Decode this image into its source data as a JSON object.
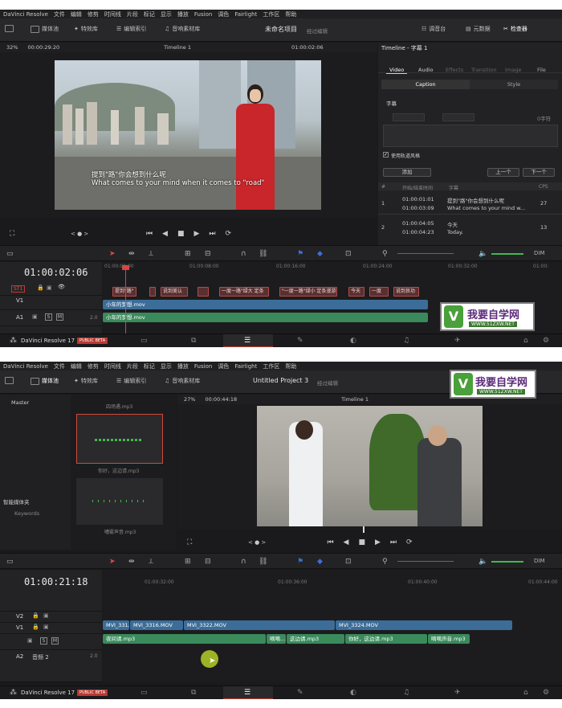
{
  "top": {
    "menu": [
      "DaVinci Resolve",
      "文件",
      "编辑",
      "修剪",
      "时间线",
      "片段",
      "标记",
      "显示",
      "播放",
      "Fusion",
      "调色",
      "Fairlight",
      "工作区",
      "帮助"
    ],
    "toolbar": {
      "media_pool": "媒体池",
      "effects": "特效库",
      "edit_index": "编辑索引",
      "sound_library": "音响素材库",
      "project_name": "未命名项目",
      "project_sub": "经过编辑",
      "mixer": "调音台",
      "metadata": "元数据",
      "inspector": "检查器"
    },
    "viewer": {
      "zoom": "32%",
      "timecode_left": "00:00:29:20",
      "timeline_name": "Timeline 1",
      "timecode_right": "01:00:02:06"
    },
    "video_caption": {
      "line1": "提到\"路\"你会想到什么呢",
      "line2": "What comes to your mind when it comes to \"road\""
    },
    "inspector": {
      "title": "Timeline - 字幕 1",
      "tabs": [
        "Video",
        "Audio",
        "Effects",
        "Transition",
        "Image",
        "File"
      ],
      "subtabs": [
        "Caption",
        "Style"
      ],
      "section": "字幕",
      "char_count": "0字符",
      "track_style_label": "使用轨道风格",
      "add_button": "添加",
      "prev_button": "上一个",
      "next_button": "下一个",
      "table_headers": [
        "#",
        "开始/结束时间",
        "字幕",
        "CPS"
      ],
      "rows": [
        {
          "num": "1",
          "start": "01:00:01:01",
          "end": "01:00:03:09",
          "text1": "提到\"路\"你会想到什么呢",
          "text2": "What comes to your mind w...",
          "cps": "27"
        },
        {
          "num": "2",
          "start": "01:00:04:05",
          "end": "01:00:04:23",
          "text1": "今天",
          "text2": "Today.",
          "cps": "13"
        }
      ]
    },
    "timeline": {
      "timecode": "01:00:02:06",
      "ruler": [
        "01:00:00:00",
        "01:00:08:00",
        "01:00:16:00",
        "01:00:24:00",
        "01:00:32:00",
        "01:00:"
      ],
      "tracks": {
        "st1": "ST1",
        "v1": "V1",
        "a1": "A1",
        "a1_level": "2.0"
      },
      "subtitle_clips": [
        "提到\"路\"",
        "",
        "说到美认",
        "",
        "一度一路\"绿大 定条",
        "\"一度一路\"绿小 定条漫游",
        "今天",
        "一度",
        "说到良功"
      ],
      "video_clip": "小年的梦想.mov",
      "audio_clip": "小年的梦想.mov"
    },
    "pagebar": {
      "app": "DaVinci Resolve 17",
      "badge": "PUBLIC BETA"
    },
    "watermark": {
      "title": "我要自学网",
      "url": "WWW.51ZXW.NET"
    }
  },
  "bottom": {
    "menu": [
      "DaVinci Resolve",
      "文件",
      "编辑",
      "修剪",
      "时间线",
      "片段",
      "标记",
      "显示",
      "播放",
      "Fusion",
      "调色",
      "Fairlight",
      "工作区",
      "帮助"
    ],
    "toolbar": {
      "media_pool": "媒体池",
      "effects": "特效库",
      "edit_index": "编辑索引",
      "sound_library": "音响素材库",
      "project_name": "Untitled Project 3",
      "project_sub": "经过编辑"
    },
    "media": {
      "bin_master": "Master",
      "smart_bins": "智能媒体夹",
      "keywords": "Keywords",
      "thumb1": "四场遇.mp3",
      "thumb2": "你好，这边请.mp3",
      "thumb3": "嘈雾声音.mp3"
    },
    "viewer": {
      "zoom": "27%",
      "timecode_left": "00:00:44:18",
      "timeline_name": "Timeline 1"
    },
    "timeline": {
      "timecode": "01:00:21:18",
      "ruler": [
        "01:00:32:00",
        "01:00:36:00",
        "01:00:40:00",
        "01:00:44:00"
      ],
      "tracks": {
        "v2": "V2",
        "v1": "V1",
        "a2": "A2",
        "a2_name": "音频 2",
        "a2_level": "2.0"
      },
      "video_clips": [
        "MVI_331...",
        "MVI_3316.MOV",
        "MVI_3322.MOV",
        "MVI_3324.MOV"
      ],
      "audio_clips": [
        "夜间请.mp3",
        "嘀嘀...",
        "这边请.mp3",
        "你好，这边请.mp3",
        "嘀嘀声音.mp3"
      ]
    },
    "pagebar": {
      "app": "DaVinci Resolve 17",
      "badge": "PUBLIC BETA"
    },
    "watermark": {
      "title": "我要自学网",
      "url": "WWW.51ZXW.NET"
    }
  }
}
